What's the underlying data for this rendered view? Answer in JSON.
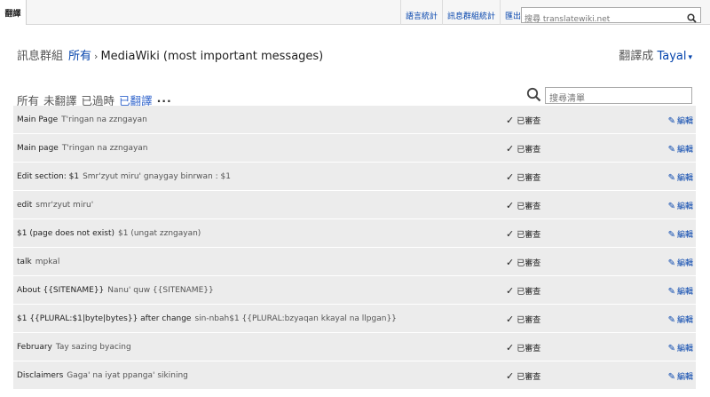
{
  "topbar": {
    "active_tab": "翻譯",
    "links": [
      "語言統計",
      "訊息群組統計",
      "匯出"
    ],
    "search_placeholder": "搜尋 translatewiki.net"
  },
  "header": {
    "label": "訊息群組",
    "breadcrumb_all": "所有",
    "separator": "›",
    "group": "MediaWiki (most important messages)",
    "translate_to_label": "翻譯成",
    "language": "Tayal",
    "caret": "▾"
  },
  "filters": {
    "tabs": [
      "所有",
      "未翻譯",
      "已過時",
      "已翻譯"
    ],
    "active": "已翻譯",
    "more": "...",
    "search_placeholder": "搜尋清單"
  },
  "rows": [
    {
      "source": "Main Page",
      "translation": "T'ringan na zzngayan",
      "status": "已審查",
      "edit": "編輯"
    },
    {
      "source": "Main page",
      "translation": "T'ringan na zzngayan",
      "status": "已審查",
      "edit": "編輯"
    },
    {
      "source": "Edit section: $1",
      "translation": "Smr'zyut miru' gnaygay binrwan : $1",
      "status": "已審查",
      "edit": "編輯"
    },
    {
      "source": "edit",
      "translation": "smr'zyut miru'",
      "status": "已審查",
      "edit": "編輯"
    },
    {
      "source": "$1 (page does not exist)",
      "translation": "$1 (ungat zzngayan)",
      "status": "已審查",
      "edit": "編輯"
    },
    {
      "source": "talk",
      "translation": "mpkal",
      "status": "已審查",
      "edit": "編輯"
    },
    {
      "source": "About {{SITENAME}}",
      "translation": "Nanu' quw {{SITENAME}}",
      "status": "已審查",
      "edit": "編輯"
    },
    {
      "source": "$1 {{PLURAL:$1|byte|bytes}} after change",
      "translation": "sin-nbah$1 {{PLURAL:bzyaqan kkayal na llpgan}}",
      "status": "已審查",
      "edit": "編輯"
    },
    {
      "source": "February",
      "translation": "Tay sazing byacing",
      "status": "已審查",
      "edit": "編輯"
    },
    {
      "source": "Disclaimers",
      "translation": "Gaga' na iyat ppanga' sikining",
      "status": "已審查",
      "edit": "編輯"
    }
  ]
}
